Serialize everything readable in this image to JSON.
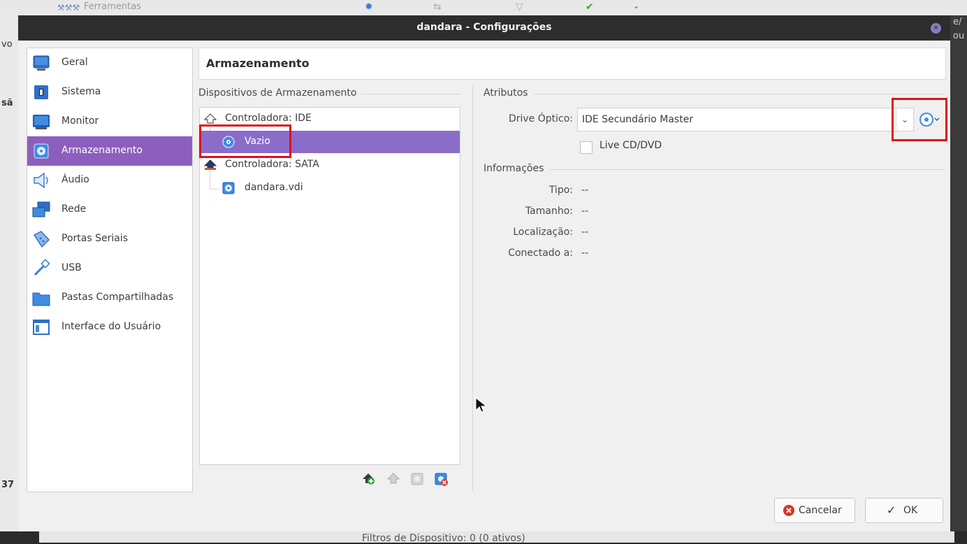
{
  "background": {
    "toolbar_label": "Ferramentas",
    "bottom_text": "Filtros de Dispositivo:   0 (0 ativos)"
  },
  "window": {
    "title": "dandara - Configurações"
  },
  "sidebar": {
    "items": [
      {
        "label": "Geral",
        "icon": "general-icon"
      },
      {
        "label": "Sistema",
        "icon": "system-icon"
      },
      {
        "label": "Monitor",
        "icon": "monitor-icon"
      },
      {
        "label": "Armazenamento",
        "icon": "storage-icon",
        "active": true
      },
      {
        "label": "Áudio",
        "icon": "audio-icon"
      },
      {
        "label": "Rede",
        "icon": "network-icon"
      },
      {
        "label": "Portas Seriais",
        "icon": "serial-ports-icon"
      },
      {
        "label": "USB",
        "icon": "usb-icon"
      },
      {
        "label": "Pastas Compartilhadas",
        "icon": "shared-folders-icon"
      },
      {
        "label": "Interface do Usuário",
        "icon": "user-interface-icon"
      }
    ]
  },
  "page": {
    "title": "Armazenamento"
  },
  "storage": {
    "group_label": "Dispositivos de Armazenamento",
    "tree": [
      {
        "label": "Controladora: IDE",
        "type": "controller"
      },
      {
        "label": "Vazio",
        "type": "optical",
        "selected": true
      },
      {
        "label": "Controladora: SATA",
        "type": "controller"
      },
      {
        "label": "dandara.vdi",
        "type": "disk"
      }
    ]
  },
  "attributes": {
    "group_label": "Atributos",
    "optical_drive_label": "Drive Óptico:",
    "optical_drive_value": "IDE Secundário Master",
    "live_cd_label": "Live CD/DVD",
    "live_cd_checked": false
  },
  "info": {
    "group_label": "Informações",
    "rows": [
      {
        "label": "Tipo:",
        "value": "--"
      },
      {
        "label": "Tamanho:",
        "value": "--"
      },
      {
        "label": "Localização:",
        "value": "--"
      },
      {
        "label": "Conectado a:",
        "value": "--"
      }
    ]
  },
  "buttons": {
    "cancel": "Cancelar",
    "ok": "OK"
  },
  "colors": {
    "accent": "#8c5fbe",
    "highlight_box": "#e0101c"
  }
}
